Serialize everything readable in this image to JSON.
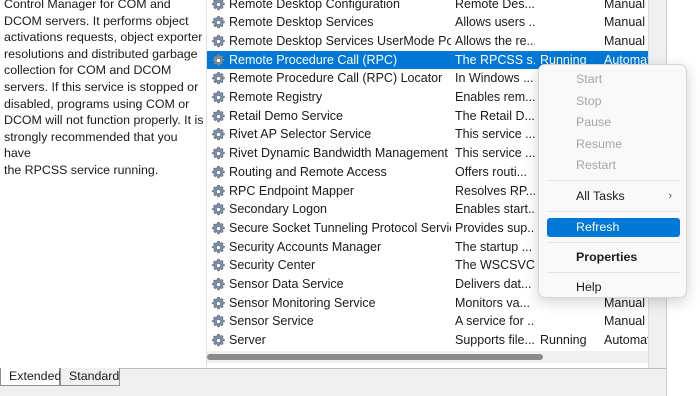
{
  "description": {
    "lines": [
      "Control Manager for COM and",
      "DCOM servers. It performs object",
      "activations requests, object exporter",
      "resolutions and distributed garbage",
      "collection for COM and DCOM",
      "servers. If this service is stopped or",
      "disabled, programs using COM or",
      "DCOM will not function properly. It is",
      "strongly recommended that you have",
      "the RPCSS service running."
    ]
  },
  "services": [
    {
      "name": "Remote Desktop Configuration",
      "description": "Remote Des...",
      "status": "",
      "startup": "Manual"
    },
    {
      "name": "Remote Desktop Services",
      "description": "Allows users ...",
      "status": "",
      "startup": "Manual"
    },
    {
      "name": "Remote Desktop Services UserMode Port...",
      "description": "Allows the re...",
      "status": "",
      "startup": "Manual"
    },
    {
      "name": "Remote Procedure Call (RPC)",
      "description": "The RPCSS s...",
      "status": "Running",
      "startup": "Automat",
      "selected": true
    },
    {
      "name": "Remote Procedure Call (RPC) Locator",
      "description": "In Windows ...",
      "status": "",
      "startup": ""
    },
    {
      "name": "Remote Registry",
      "description": "Enables rem...",
      "status": "",
      "startup": ""
    },
    {
      "name": "Retail Demo Service",
      "description": "The Retail D...",
      "status": "",
      "startup": ""
    },
    {
      "name": "Rivet AP Selector Service",
      "description": "This service ...",
      "status": "",
      "startup": ""
    },
    {
      "name": "Rivet Dynamic Bandwidth Management",
      "description": "This service ...",
      "status": "",
      "startup": ""
    },
    {
      "name": "Routing and Remote Access",
      "description": "Offers routi...",
      "status": "",
      "startup": ""
    },
    {
      "name": "RPC Endpoint Mapper",
      "description": "Resolves RP...",
      "status": "",
      "startup": ""
    },
    {
      "name": "Secondary Logon",
      "description": "Enables start...",
      "status": "",
      "startup": ""
    },
    {
      "name": "Secure Socket Tunneling Protocol Service",
      "description": "Provides sup...",
      "status": "",
      "startup": ""
    },
    {
      "name": "Security Accounts Manager",
      "description": "The startup ...",
      "status": "",
      "startup": ""
    },
    {
      "name": "Security Center",
      "description": "The WSCSVC...",
      "status": "",
      "startup": ""
    },
    {
      "name": "Sensor Data Service",
      "description": "Delivers dat...",
      "status": "",
      "startup": ""
    },
    {
      "name": "Sensor Monitoring Service",
      "description": "Monitors va...",
      "status": "",
      "startup": "Manual"
    },
    {
      "name": "Sensor Service",
      "description": "A service for ...",
      "status": "",
      "startup": "Manual"
    },
    {
      "name": "Server",
      "description": "Supports file...",
      "status": "Running",
      "startup": "Automat"
    }
  ],
  "context_menu": {
    "start": "Start",
    "stop": "Stop",
    "pause": "Pause",
    "resume": "Resume",
    "restart": "Restart",
    "all_tasks": "All Tasks",
    "refresh": "Refresh",
    "properties": "Properties",
    "help": "Help"
  },
  "tabs": {
    "extended": "Extended",
    "standard": "Standard"
  },
  "icons": {
    "service": "gear-icon",
    "submenu": "chevron-right-icon"
  },
  "colors": {
    "selection": "#0078d7",
    "disabled_text": "#a6a6a6"
  }
}
